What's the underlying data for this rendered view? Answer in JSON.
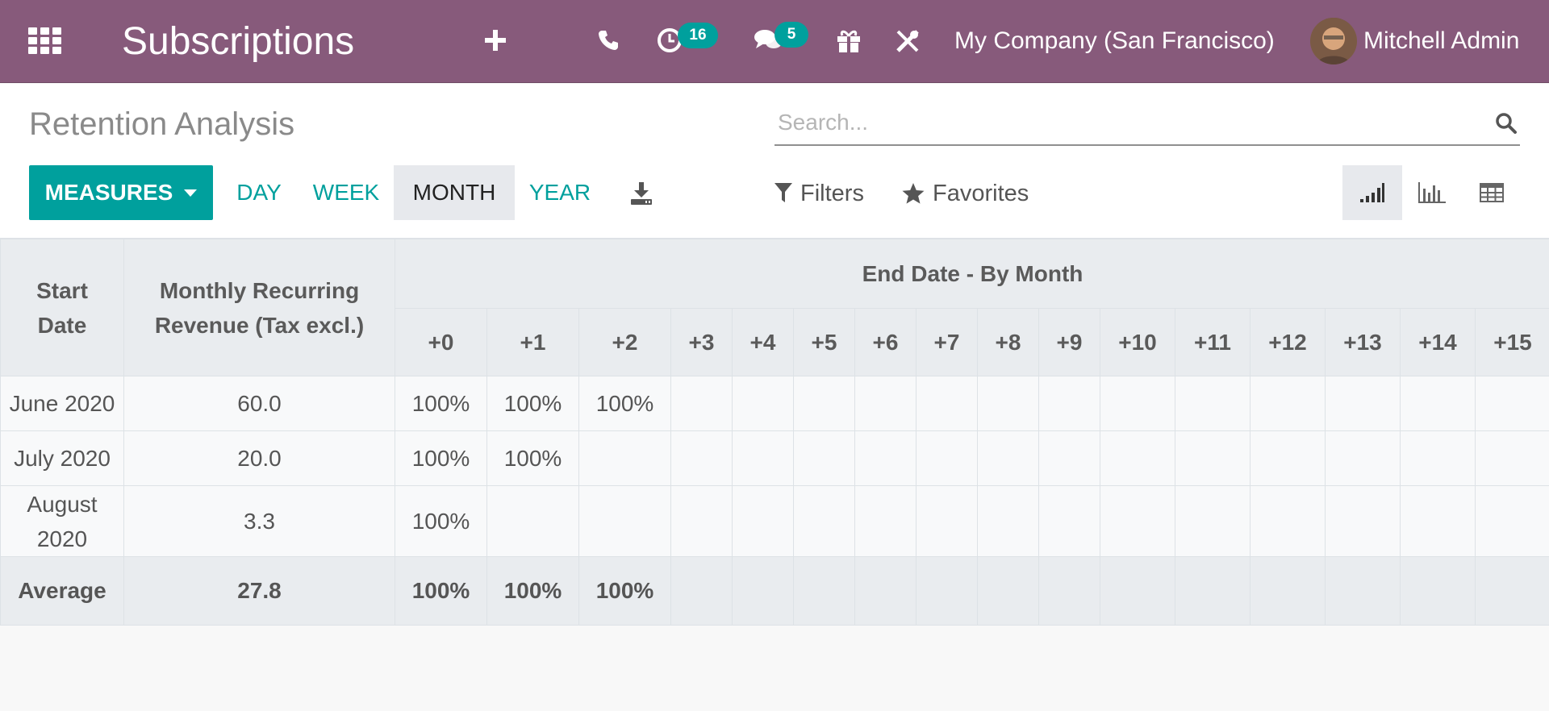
{
  "navbar": {
    "app_title": "Subscriptions",
    "icons": [
      "apps-icon",
      "plus-icon",
      "phone-icon",
      "clock-icon",
      "chat-icon",
      "gift-icon",
      "tools-icon"
    ],
    "activity_count": "16",
    "message_count": "5",
    "company": "My Company (San Francisco)",
    "user_name": "Mitchell Admin",
    "color": "#875a7b"
  },
  "control_panel": {
    "breadcrumb": "Retention Analysis",
    "search_placeholder": "Search...",
    "measures_label": "MEASURES",
    "intervals": [
      "DAY",
      "WEEK",
      "MONTH",
      "YEAR"
    ],
    "active_interval": "MONTH",
    "filters_label": "Filters",
    "favorites_label": "Favorites",
    "views": [
      "cohort",
      "graph",
      "pivot"
    ],
    "active_view": "cohort",
    "accent_color": "#00a09d"
  },
  "cohort_table": {
    "header": {
      "start_date": "Start Date",
      "measure": "Monthly Recurring Revenue (Tax excl.)",
      "group": "End Date - By Month",
      "periods": [
        "+0",
        "+1",
        "+2",
        "+3",
        "+4",
        "+5",
        "+6",
        "+7",
        "+8",
        "+9",
        "+10",
        "+11",
        "+12",
        "+13",
        "+14",
        "+15"
      ]
    },
    "rows": [
      {
        "date": "June 2020",
        "value": "60.0",
        "cells": [
          "100%",
          "100%",
          "100%",
          "",
          "",
          "",
          "",
          "",
          "",
          "",
          "",
          "",
          "",
          "",
          "",
          ""
        ]
      },
      {
        "date": "July 2020",
        "value": "20.0",
        "cells": [
          "100%",
          "100%",
          "",
          "",
          "",
          "",
          "",
          "",
          "",
          "",
          "",
          "",
          "",
          "",
          "",
          ""
        ]
      },
      {
        "date": "August 2020",
        "value": "3.3",
        "cells": [
          "100%",
          "",
          "",
          "",
          "",
          "",
          "",
          "",
          "",
          "",
          "",
          "",
          "",
          "",
          "",
          ""
        ]
      }
    ],
    "average": {
      "label": "Average",
      "value": "27.8",
      "cells": [
        "100%",
        "100%",
        "100%",
        "",
        "",
        "",
        "",
        "",
        "",
        "",
        "",
        "",
        "",
        "",
        "",
        ""
      ]
    }
  }
}
